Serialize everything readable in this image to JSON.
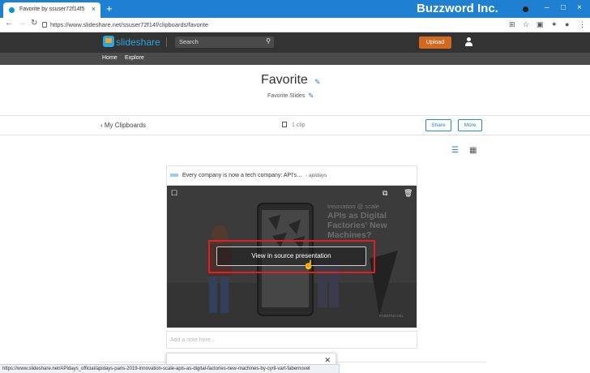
{
  "browser": {
    "tab_title": "Favorite by ssuser72f14f5",
    "tab_close": "×",
    "new_tab": "+",
    "brand": "Buzzword Inc.",
    "url": "https://www.slideshare.net/ssuser72f14f/clipboards/favorite",
    "status_url": "https://www.slideshare.net/APIdays_official/apidays-paris-2019-innovation-scale-apis-as-digital-factories-new-machines-by-cyril-vart-fabernovel",
    "window_controls": [
      "–",
      "□",
      "×"
    ]
  },
  "site": {
    "logo_text": "slideshare",
    "search_placeholder": "Search",
    "upload_label": "Upload",
    "nav": [
      "Home",
      "Explore"
    ]
  },
  "page": {
    "title": "Favorite",
    "subtitle": "Favorite Slides",
    "back_label": "My Clipboards",
    "clip_count": "1 clip",
    "share_label": "Share",
    "more_label": "More"
  },
  "card": {
    "title": "Every company is now a tech company: API's…",
    "author": "- apidays",
    "slide_lines": [
      "Innovation @ scale",
      "APIs as Digital",
      "Factories' New",
      "Machines?"
    ],
    "slide_logo": "FABERNOVEL",
    "view_button": "View in source presentation",
    "note_placeholder": "Add a note here…"
  },
  "colors": {
    "tab_bar": "#1f7fd0",
    "site_header": "#333333",
    "upload": "#d2691e",
    "accent": "#2a86c7",
    "highlight": "#e02020"
  },
  "icons": {
    "search": "search-icon",
    "pencil": "pencil-icon",
    "copy": "copy-icon",
    "trash": "trash-icon",
    "list_view": "list-view-icon",
    "grid_view": "grid-view-icon"
  }
}
